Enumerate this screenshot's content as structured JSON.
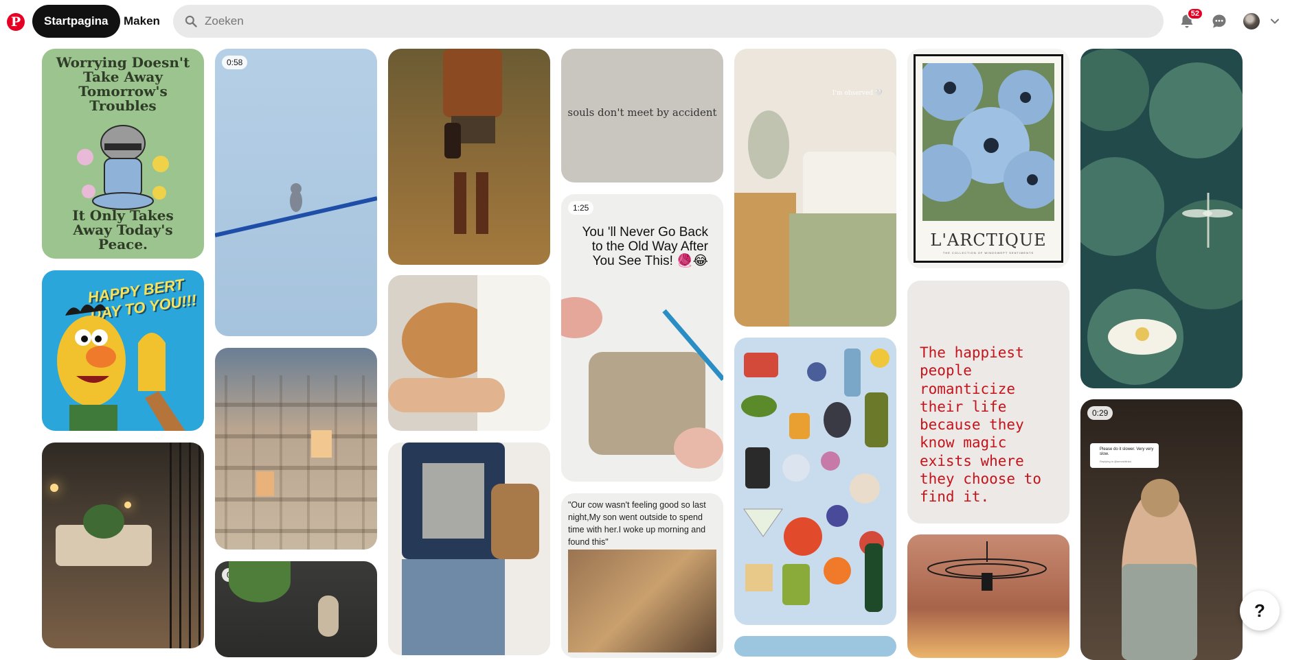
{
  "colors": {
    "brand": "#e60023",
    "nav_active_bg": "#111111",
    "search_bg": "#e9e9e9"
  },
  "header": {
    "logo_icon": "pinterest-logo",
    "logo_glyph": "P",
    "nav_home": "Startpagina",
    "nav_create": "Maken",
    "search_placeholder": "Zoeken",
    "notifications_count": "52",
    "icons": [
      "bell-icon",
      "chat-icon",
      "avatar",
      "chevron-down-icon"
    ]
  },
  "pins": {
    "raccoon_top": "Worrying Doesn't Take Away Tomorrow's Troubles",
    "raccoon_bottom": "It Only Takes Away Today's Peace.",
    "bert_text": "HAPPY BERT DAY TO YOU!!!",
    "cat_video_time": "0:58",
    "souls_text": "souls don't meet by accident",
    "crochet_time": "1:25",
    "crochet_text": "You 'll Never Go Back to the Old Way After You See This! 🧶😂",
    "cow_quote": "\"Our cow wasn't feeling good so last night,My son went outside to spend time with her.I woke up morning and found this\"",
    "bed_overlay": "I'm observed 🤍",
    "poster_title": "L'ARCTIQUE",
    "poster_sub": "THE COLLECTION OF WINDSWEPT SENTIMENTS",
    "happiest_text": "The happiest people romanticize their life because they know magic exists where they choose to find it.",
    "plant_video_time": "0:16",
    "back_video_time": "0:29",
    "comment_text": "Please do it slower. Very very slow.",
    "comment_reply": "Replying to @aeroshtinkd"
  },
  "help_button": "?"
}
